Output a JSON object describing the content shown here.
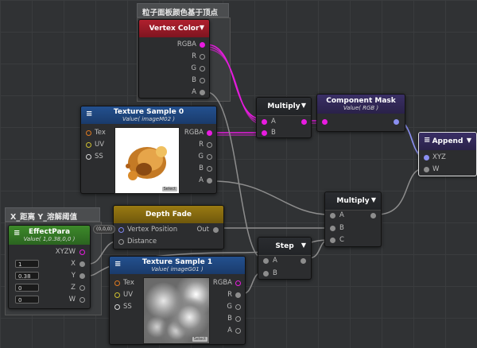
{
  "group_top": {
    "title": "粒子面板颜色基于顶点"
  },
  "group_left": {
    "title": "X_距离 Y_溶解阈值"
  },
  "vertex_color": {
    "title": "Vertex Color",
    "ports": [
      "RGBA",
      "R",
      "G",
      "B",
      "A"
    ]
  },
  "tex0": {
    "title": "Texture Sample 0",
    "sub": "Value( imageM02 )",
    "inputs": [
      "Tex",
      "UV",
      "SS"
    ],
    "outputs": [
      "RGBA",
      "R",
      "G",
      "B",
      "A"
    ],
    "select": "Select"
  },
  "multiply1": {
    "title": "Multiply",
    "inputs": [
      "A",
      "B"
    ]
  },
  "component_mask": {
    "title": "Component Mask",
    "sub": "Value( RGB )"
  },
  "append": {
    "title": "Append",
    "inputs": [
      "XYZ",
      "W"
    ]
  },
  "depth_fade": {
    "title": "Depth Fade",
    "inputs": [
      "Vertex Position",
      "Distance"
    ],
    "output": "Out"
  },
  "multiply2": {
    "title": "Multiply",
    "inputs": [
      "A",
      "B",
      "C"
    ]
  },
  "step": {
    "title": "Step",
    "inputs": [
      "A",
      "B"
    ]
  },
  "effect_para": {
    "title": "EffectPara",
    "sub": "Value( 1,0.38,0,0 )",
    "badge": "(0,0,0)",
    "outputs": [
      "XYZW",
      "X",
      "Y",
      "Z",
      "W"
    ],
    "values": [
      "1",
      "0.38",
      "0",
      "0"
    ]
  },
  "tex1": {
    "title": "Texture Sample 1",
    "sub": "Value( imageG01 )",
    "inputs": [
      "Tex",
      "UV",
      "SS"
    ],
    "outputs": [
      "RGBA",
      "R",
      "G",
      "B",
      "A"
    ],
    "select": "Select"
  },
  "colors": {
    "magenta": "#e81ce0",
    "grey_wire": "#8d8d8d",
    "blue_wire": "#8a8ff0"
  }
}
